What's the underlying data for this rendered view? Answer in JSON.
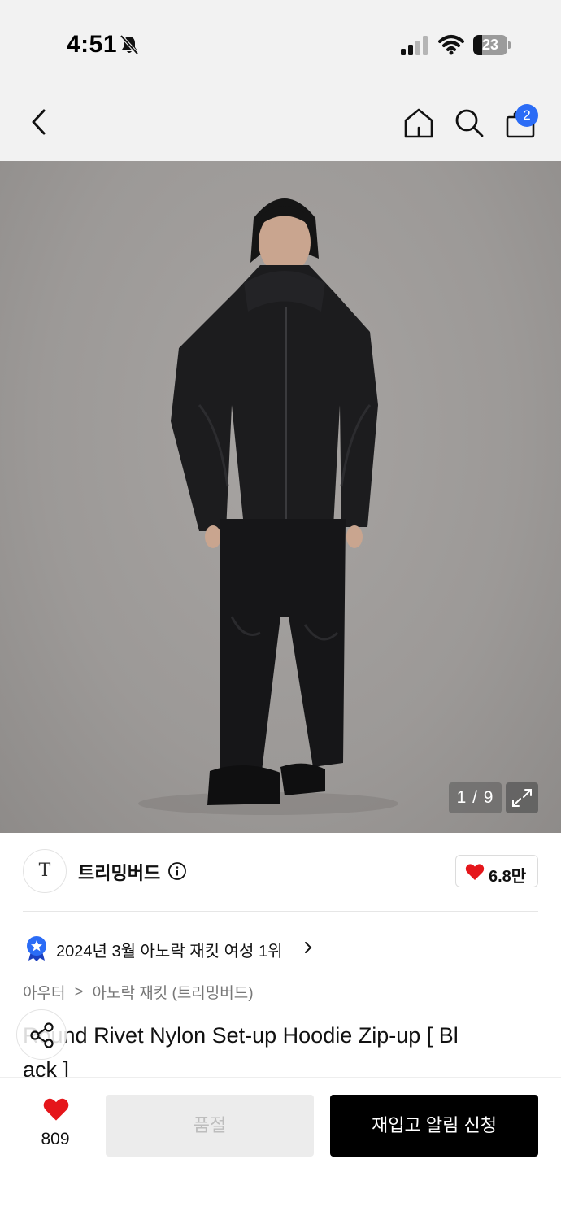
{
  "status_bar": {
    "time": "4:51",
    "battery": "23",
    "icons": [
      "bell-slash-icon",
      "signal-icon",
      "wifi-icon",
      "battery-icon"
    ]
  },
  "nav": {
    "icons": [
      "back-chevron-icon",
      "home-icon",
      "search-icon",
      "shopping-bag-icon"
    ],
    "cart_count": "2"
  },
  "gallery": {
    "counter": "1 / 9",
    "expand_icon": "expand-arrows-icon"
  },
  "brand": {
    "logo_text": "T",
    "name": "트리밍버드",
    "info_icon": "info-icon",
    "likes": "6.8만"
  },
  "ranking": {
    "text": "2024년 3월 아노락 재킷 여성 1위",
    "icon": "medal-icon"
  },
  "breadcrumb": {
    "level1": "아우터",
    "separator": ">",
    "level2": "아노락 재킷 (트리밍버드)"
  },
  "product": {
    "title_line1": "Round Rivet Nylon Set-up Hoodie Zip-up [ Bl",
    "title_line2": "ack ]"
  },
  "share": {
    "icon": "share-icon"
  },
  "bottom": {
    "wish_count": "809",
    "soldout_label": "품절",
    "restock_label": "재입고 알림 신청"
  },
  "colors": {
    "accent_blue": "#2b6cf6",
    "heart_red": "#e5161b",
    "cta_black": "#000000",
    "disabled_gray": "#ececec"
  }
}
